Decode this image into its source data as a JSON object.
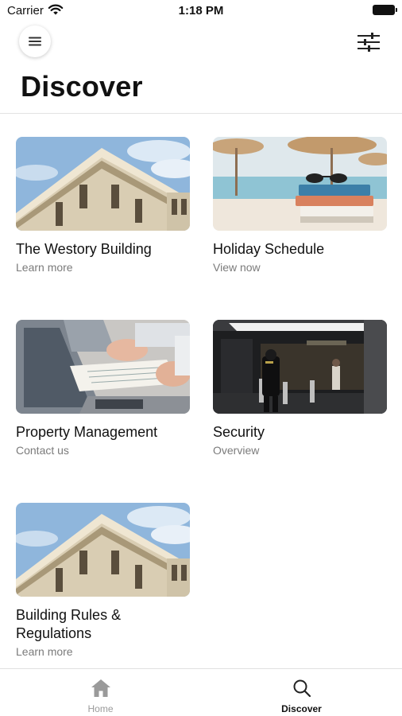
{
  "status_bar": {
    "carrier": "Carrier",
    "time": "1:18 PM"
  },
  "header": {
    "title": "Discover",
    "menu_icon": "hamburger-icon",
    "filter_icon": "sliders-icon"
  },
  "cards": [
    {
      "title": "The Westory Building",
      "subtitle": "Learn more",
      "image": "building-facade"
    },
    {
      "title": "Holiday Schedule",
      "subtitle": "View now",
      "image": "beach-books"
    },
    {
      "title": "Property Management",
      "subtitle": "Contact us",
      "image": "laptop-documents"
    },
    {
      "title": "Security",
      "subtitle": "Overview",
      "image": "lobby-guard"
    },
    {
      "title": "Building Rules & Regulations",
      "subtitle": "Learn more",
      "image": "building-facade"
    }
  ],
  "tab_bar": {
    "tabs": [
      {
        "label": "Home",
        "icon": "home-icon",
        "active": false
      },
      {
        "label": "Discover",
        "icon": "search-icon",
        "active": true
      }
    ]
  }
}
